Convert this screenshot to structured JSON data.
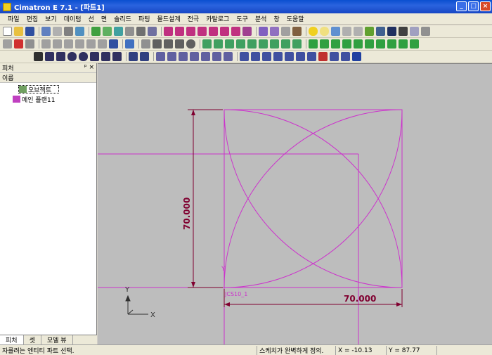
{
  "window": {
    "title": "Cimatron E 7.1 - [파트1]"
  },
  "menu": [
    "파일",
    "편집",
    "보기",
    "데이텀",
    "선",
    "면",
    "솔리드",
    "파팅",
    "몰드설계",
    "전극",
    "카탈로그",
    "도구",
    "분석",
    "창",
    "도움말"
  ],
  "feature_panel": {
    "title": "피처",
    "column_header": "이름",
    "items": [
      {
        "label": "오브젝트"
      },
      {
        "label": "메인 플랜11"
      }
    ],
    "tabs": [
      "피처",
      "셋",
      "모델 뷰"
    ]
  },
  "viewport": {
    "dimension_vertical": "70.000",
    "dimension_horizontal": "70.000",
    "csys_label": "JCS10_1",
    "axis_x": "X",
    "axis_y": "Y",
    "small_axis_y": "Y"
  },
  "status": {
    "hint": "자를려는 엔티티 파트 선택.",
    "sketch_state": "스케치가 완벽하게 정의.",
    "x_coord": "X = -10.13",
    "y_coord": "Y = 87.77"
  },
  "colors": {
    "sketch": "#cc33cc",
    "dimension": "#800030",
    "background": "#bdbdbd"
  }
}
